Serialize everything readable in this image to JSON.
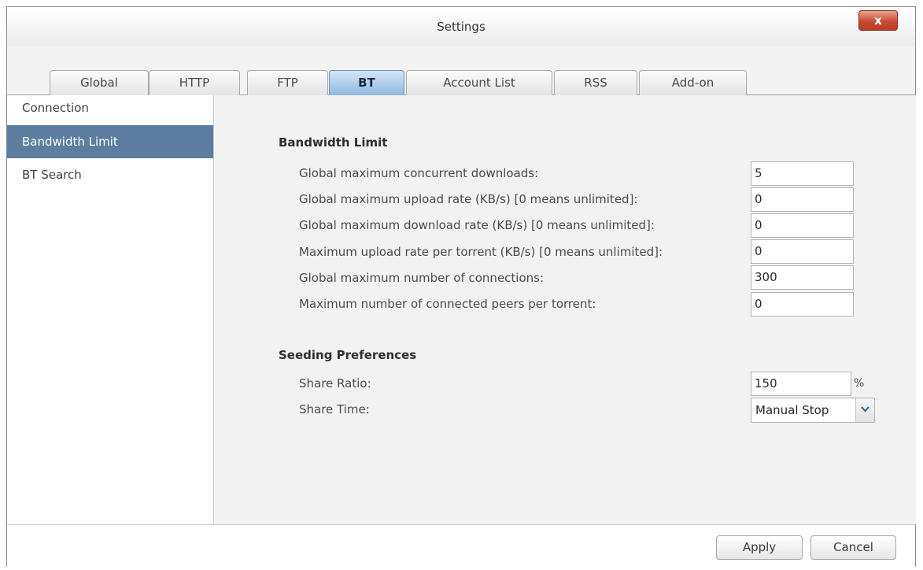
{
  "window": {
    "title": "Settings",
    "close_label": "x"
  },
  "tabs": [
    "Global",
    "HTTP",
    "FTP",
    "BT",
    "Account List",
    "RSS",
    "Add-on"
  ],
  "active_tab": "BT",
  "sidebar": {
    "items": [
      "Connection",
      "Bandwidth Limit",
      "BT Search"
    ],
    "active": "Bandwidth Limit"
  },
  "bandwidth": {
    "title": "Bandwidth Limit",
    "rows": [
      {
        "label": "Global maximum concurrent downloads:",
        "value": "5"
      },
      {
        "label": "Global maximum upload rate (KB/s) [0 means unlimited]:",
        "value": "0"
      },
      {
        "label": "Global maximum download rate (KB/s) [0 means unlimited]:",
        "value": "0"
      },
      {
        "label": "Maximum upload rate per torrent (KB/s) [0 means unlimited]:",
        "value": "0"
      },
      {
        "label": "Global maximum number of connections:",
        "value": "300"
      },
      {
        "label": "Maximum number of connected peers per torrent:",
        "value": "0"
      }
    ]
  },
  "seeding": {
    "title": "Seeding Preferences",
    "share_ratio_label": "Share Ratio:",
    "share_ratio_value": "150",
    "share_ratio_unit": "%",
    "share_time_label": "Share Time:",
    "share_time_value": "Manual Stop"
  },
  "footer": {
    "apply_label": "Apply",
    "cancel_label": "Cancel"
  },
  "colors": {
    "active_tab": "#8eb6de",
    "sidebar_active": "#5c7d9e",
    "close_button": "#c94a34"
  }
}
